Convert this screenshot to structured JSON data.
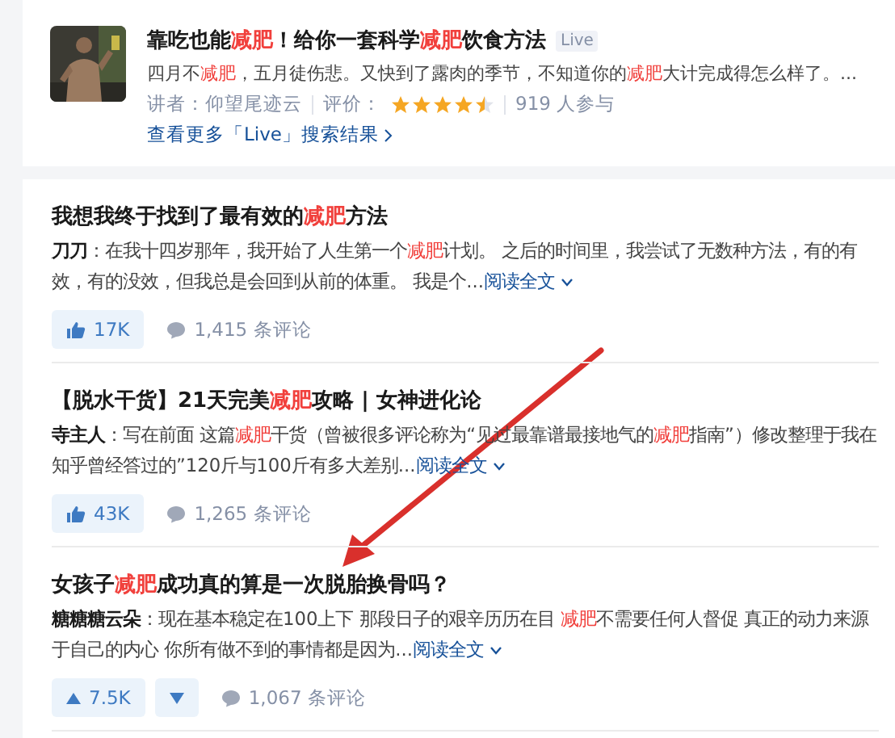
{
  "live_card": {
    "title": [
      {
        "text": "靠吃也能"
      },
      {
        "text": "减肥",
        "highlight": true
      },
      {
        "text": "！给你一套科学"
      },
      {
        "text": "减肥",
        "highlight": true
      },
      {
        "text": "饮食方法"
      }
    ],
    "badge": "Live",
    "description": [
      {
        "text": "四月不"
      },
      {
        "text": "减肥",
        "highlight": true
      },
      {
        "text": "，五月徒伤悲。又快到了露肉的季节，不知道你的"
      },
      {
        "text": "减肥",
        "highlight": true
      },
      {
        "text": "大计完成得怎么样了。..."
      }
    ],
    "speaker": "讲者：仰望尾迹云",
    "rating_label": "评价：",
    "stars": 4.5,
    "participants": "919 人参与",
    "more_link": "查看更多「Live」搜索结果"
  },
  "answers": [
    {
      "kind": "thumb",
      "title": [
        {
          "text": "我想我终于找到了最有效的"
        },
        {
          "text": "减肥",
          "highlight": true
        },
        {
          "text": "方法"
        }
      ],
      "author": "刀刀",
      "excerpt": [
        {
          "text": "：在我十四岁那年，我开始了人生第一个"
        },
        {
          "text": "减肥",
          "highlight": true
        },
        {
          "text": "计划。 之后的时间里，我尝试了无数种方法，有的有效，有的没效，但我总是会回到从前的体重。 我是个..."
        }
      ],
      "read_more": "阅读全文",
      "votes": "17K",
      "comments": "1,415 条评论"
    },
    {
      "kind": "thumb",
      "title": [
        {
          "text": "【脱水干货】21天完美"
        },
        {
          "text": "减肥",
          "highlight": true
        },
        {
          "text": "攻略 | 女神进化论"
        }
      ],
      "author": "寺主人",
      "excerpt": [
        {
          "text": "：写在前面 这篇"
        },
        {
          "text": "减肥",
          "highlight": true
        },
        {
          "text": "干货（曾被很多评论称为“见过最靠谱最接地气的"
        },
        {
          "text": "减肥",
          "highlight": true
        },
        {
          "text": "指南”）修改整理于我在知乎曾经答过的”120斤与100斤有多大差别..."
        }
      ],
      "read_more": "阅读全文",
      "votes": "43K",
      "comments": "1,265 条评论"
    },
    {
      "kind": "updown",
      "title": [
        {
          "text": "女孩子"
        },
        {
          "text": "减肥",
          "highlight": true
        },
        {
          "text": "成功真的算是一次脱胎换骨吗？"
        }
      ],
      "author": "糖糖糖云朵",
      "excerpt": [
        {
          "text": "：现在基本稳定在100上下 那段日子的艰辛历历在目 "
        },
        {
          "text": "减肥",
          "highlight": true
        },
        {
          "text": "不需要任何人督促 真正的动力来源于自己的内心 你所有做不到的事情都是因为..."
        }
      ],
      "read_more": "阅读全文",
      "votes": "7.5K",
      "comments": "1,067 条评论"
    }
  ]
}
